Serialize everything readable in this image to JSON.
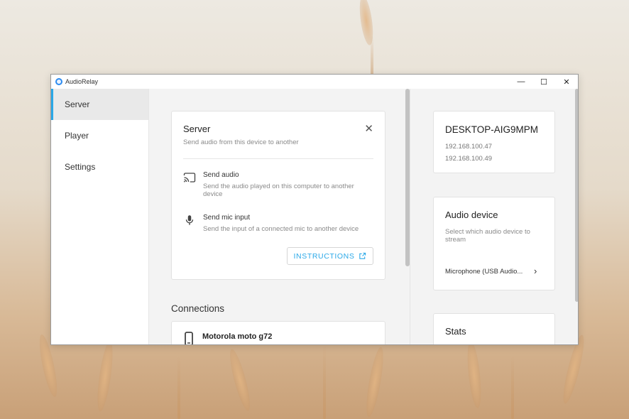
{
  "window": {
    "title": "AudioRelay",
    "minimize": "—",
    "maximize": "☐",
    "close": "✕"
  },
  "sidebar": {
    "items": [
      {
        "label": "Server",
        "active": true
      },
      {
        "label": "Player",
        "active": false
      },
      {
        "label": "Settings",
        "active": false
      }
    ]
  },
  "server_card": {
    "title": "Server",
    "subtitle": "Send audio from this device to another",
    "close_icon": "✕",
    "options": [
      {
        "icon": "cast-icon",
        "title": "Send audio",
        "description": "Send the audio played on this computer to another device"
      },
      {
        "icon": "mic-icon",
        "title": "Send mic input",
        "description": "Send the input of a connected mic to another device"
      }
    ],
    "instructions_label": "INSTRUCTIONS"
  },
  "connections": {
    "title": "Connections",
    "items": [
      {
        "name": "Motorola moto g72",
        "icon": "phone-icon"
      }
    ]
  },
  "host": {
    "name": "DESKTOP-AIG9MPM",
    "ips": [
      "192.168.100.47",
      "192.168.100.49"
    ]
  },
  "audio_device": {
    "title": "Audio device",
    "subtitle": "Select which audio device to stream",
    "selected": "Microphone (USB Audio...",
    "chevron": "›"
  },
  "stats": {
    "title": "Stats"
  },
  "colors": {
    "accent": "#2aa8e8",
    "window_bg": "#f3f3f3",
    "card_bg": "#ffffff"
  }
}
